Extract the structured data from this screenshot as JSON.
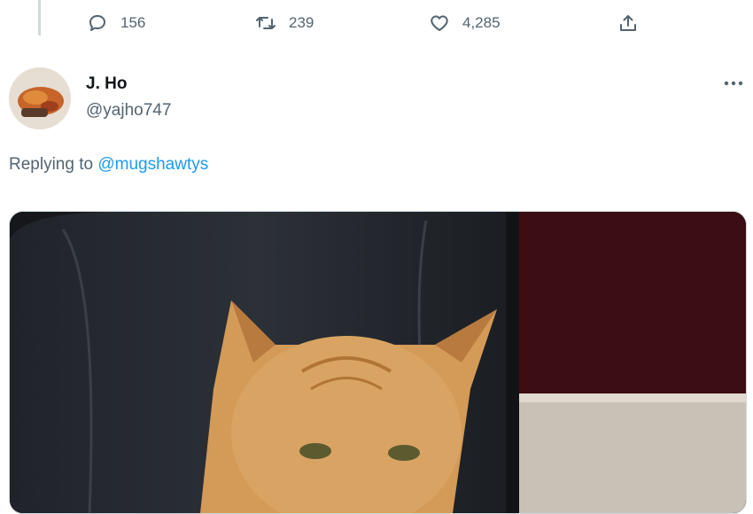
{
  "actions": {
    "reply_count": "156",
    "retweet_count": "239",
    "like_count": "4,285"
  },
  "tweet": {
    "display_name": "J. Ho",
    "handle": "@yajho747",
    "replying_prefix": "Replying to ",
    "replying_to": "@mugshawtys"
  },
  "colors": {
    "accent": "#1d9bf0",
    "muted_text": "#536471",
    "primary_text": "#0f1419"
  },
  "icons": [
    "reply-icon",
    "retweet-icon",
    "like-icon",
    "share-icon",
    "more-icon"
  ]
}
